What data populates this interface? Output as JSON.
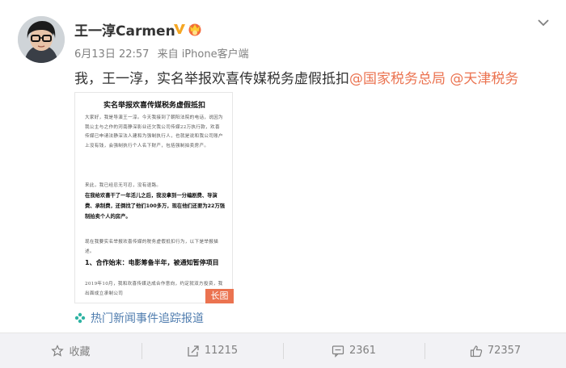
{
  "user": {
    "name": "王一淳Carmen",
    "time": "6月13日 22:57",
    "source": "来自 iPhone客户端"
  },
  "post": {
    "text": "我，王一淳，实名举报欢喜传媒税务虚假抵扣",
    "mentions": [
      "@国家税务总局",
      "@天津税务"
    ]
  },
  "document": {
    "title": "实名举报欢喜传媒税务虚假抵扣",
    "para1": "大家好，我是导演王一淳。今天我接到了朝阳法院的电话，说因为我公主与之作的河南静深影业还欠我公司传媒22万执行款，欢喜传媒已申请法静深法人建和为强制执行人，也就是说和我公司账户上没有钱，会强制执行个人名下财产，包括强制拍卖房产。",
    "para2": "来此，我已经忍无可忍，没有退路。",
    "bold": "在我给欢喜干了一年活儿之后，我没拿到一分编剧费、导演费、承制费，还倒找了他们100多万，现在他们还要为22万强制拍卖个人的房产。",
    "para3": "现在我要实名举报欢喜传媒的税务虚假抵扣行为，以下是举报描述。",
    "heading": "1、合作始末：电影筹备半年，被通知暂停项目",
    "para4": "2019年10月，我和欢喜传媒达成合作意向，约定就双方投资，我出面成立承制公司",
    "tag": "长图"
  },
  "topic": {
    "label": "热门新闻事件追踪报道"
  },
  "actions": {
    "favorite": "收藏",
    "repost": "11215",
    "comment": "2361",
    "like": "72357"
  },
  "colors": {
    "accent": "#eb7350",
    "link": "#507daf",
    "verified": "#f5a623"
  },
  "icons": [
    "verified-v-icon",
    "member-crown-icon",
    "chevron-down-icon",
    "topic-flower-icon",
    "star-icon",
    "repost-icon",
    "comment-icon",
    "like-icon"
  ]
}
